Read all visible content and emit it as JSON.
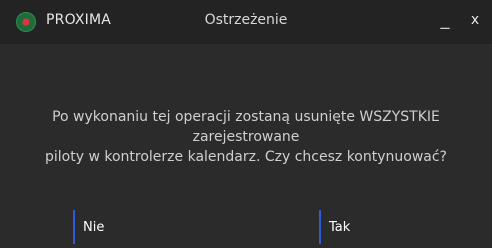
{
  "titlebar": {
    "app_name": "PROXIMA",
    "title": "Ostrzeżenie",
    "minimize_label": "_",
    "close_label": "x"
  },
  "dialog": {
    "message_line1": "Po wykonaniu tej operacji zostaną usunięte WSZYSTKIE zarejestrowane",
    "message_line2": "piloty w kontrolerze kalendarz. Czy chcesz kontynuować?"
  },
  "buttons": {
    "no_label": "Nie",
    "yes_label": "Tak"
  },
  "colors": {
    "background": "#2b2b2b",
    "titlebar": "#232323",
    "accent": "#2f5bd9",
    "logo_red": "#e0343f",
    "logo_green": "#1f6b3a"
  },
  "icons": {
    "app_logo": "proxima-logo-icon"
  }
}
